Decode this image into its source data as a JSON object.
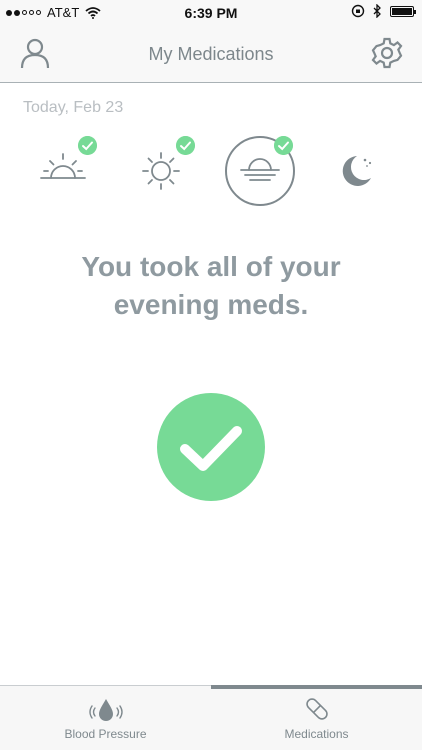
{
  "status_bar": {
    "carrier": "AT&T",
    "time": "6:39 PM"
  },
  "header": {
    "title": "My Medications"
  },
  "date_label": "Today, Feb 23",
  "time_slots": [
    {
      "name": "sunrise",
      "completed": true,
      "selected": false
    },
    {
      "name": "midday",
      "completed": true,
      "selected": false
    },
    {
      "name": "evening",
      "completed": true,
      "selected": true
    },
    {
      "name": "night",
      "completed": false,
      "selected": false
    }
  ],
  "message": {
    "line1": "You took all of your",
    "line2": "evening meds."
  },
  "tabs": [
    {
      "label": "Blood Pressure",
      "icon": "blood-drop-icon",
      "active": false
    },
    {
      "label": "Medications",
      "icon": "pill-icon",
      "active": true
    }
  ],
  "colors": {
    "accent_green": "#77da96",
    "icon_gray": "#7f898e",
    "text_gray": "#8f9aa0"
  }
}
